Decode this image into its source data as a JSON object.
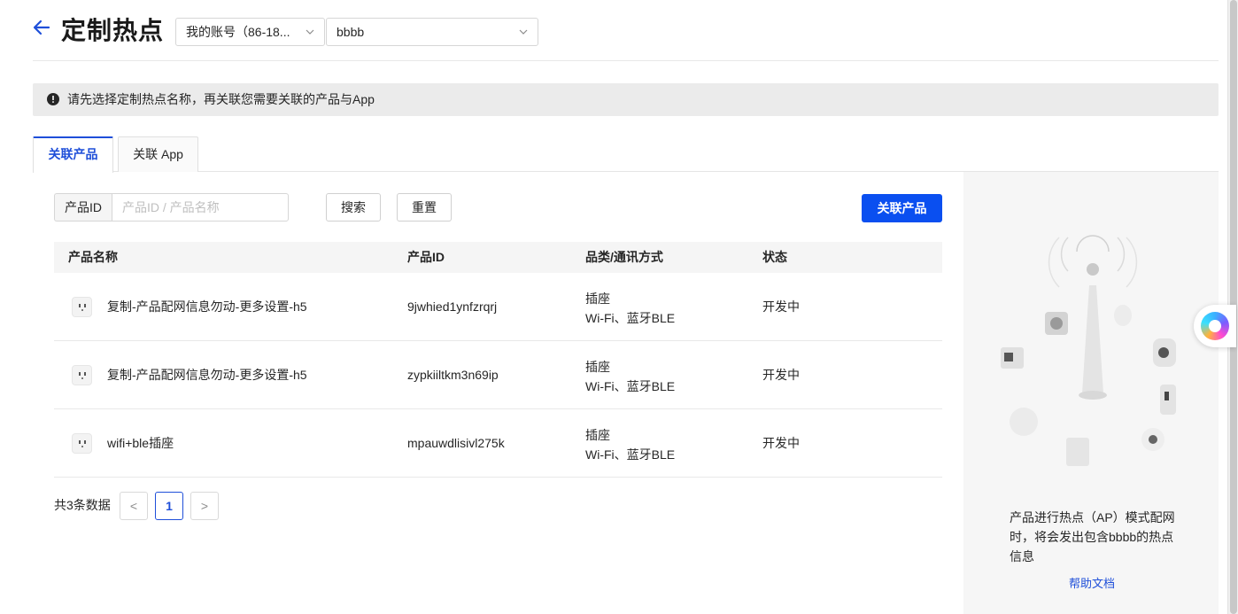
{
  "header": {
    "title": "定制热点",
    "account_select": "我的账号（86-18...",
    "hotspot_select": "bbbb"
  },
  "alert": {
    "text": "请先选择定制热点名称，再关联您需要关联的产品与App"
  },
  "tabs": [
    {
      "label": "关联产品",
      "active": true
    },
    {
      "label": "关联 App",
      "active": false
    }
  ],
  "filter": {
    "label": "产品ID",
    "placeholder": "产品ID / 产品名称",
    "search_label": "搜索",
    "reset_label": "重置",
    "link_product_label": "关联产品"
  },
  "table": {
    "columns": [
      "产品名称",
      "产品ID",
      "品类/通讯方式",
      "状态"
    ],
    "rows": [
      {
        "name": "复制-产品配网信息勿动-更多设置-h5",
        "id": "9jwhied1ynfzrqrj",
        "category": "插座",
        "comm": "Wi-Fi、蓝牙BLE",
        "status": "开发中"
      },
      {
        "name": "复制-产品配网信息勿动-更多设置-h5",
        "id": "zypkiiltkm3n69ip",
        "category": "插座",
        "comm": "Wi-Fi、蓝牙BLE",
        "status": "开发中"
      },
      {
        "name": "wifi+ble插座",
        "id": "mpauwdlisivl275k",
        "category": "插座",
        "comm": "Wi-Fi、蓝牙BLE",
        "status": "开发中"
      }
    ]
  },
  "pagination": {
    "total_text": "共3条数据",
    "current_page": "1",
    "prev": "<",
    "next": ">"
  },
  "side": {
    "description": "产品进行热点（AP）模式配网时，将会发出包含bbbb的热点信息",
    "help_link": "帮助文档"
  },
  "colors": {
    "primary": "#0a4ff0",
    "link": "#1f4fd9"
  },
  "icons": [
    "back-arrow-icon",
    "chevron-down-icon",
    "alert-exclamation-icon",
    "socket-icon",
    "app-assistant-icon"
  ]
}
